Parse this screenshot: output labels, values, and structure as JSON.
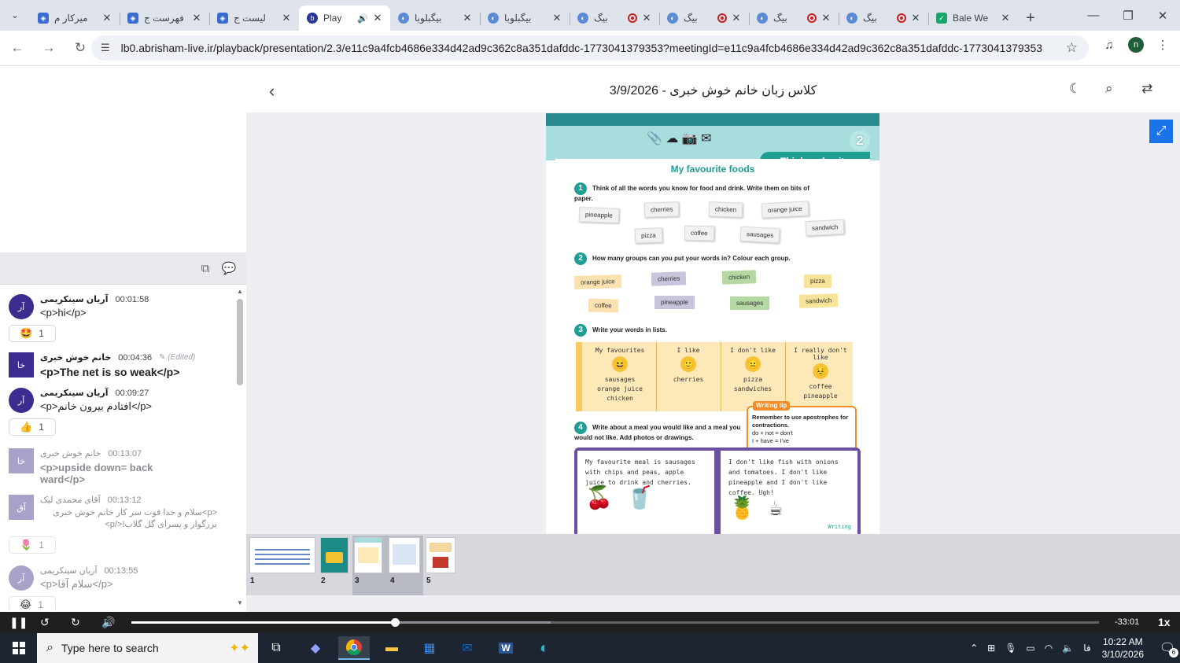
{
  "browser": {
    "tabs": [
      {
        "title": "میرکار م",
        "favicon": "app-icon",
        "active": false,
        "recording": false
      },
      {
        "title": "فهرست ج",
        "favicon": "app-icon",
        "active": false,
        "recording": false
      },
      {
        "title": "لیست ج",
        "favicon": "app-icon",
        "active": false,
        "recording": false
      },
      {
        "title": "Play",
        "favicon": "bbb-icon",
        "active": true,
        "recording": false,
        "audio": true
      },
      {
        "title": "بیگبلوبا",
        "favicon": "bbb-icon",
        "active": false,
        "recording": false
      },
      {
        "title": "بیگبلوبا",
        "favicon": "bbb-icon",
        "active": false,
        "recording": false
      },
      {
        "title": "بیگ",
        "favicon": "bbb-icon",
        "active": false,
        "recording": true
      },
      {
        "title": "بیگ",
        "favicon": "bbb-icon",
        "active": false,
        "recording": true
      },
      {
        "title": "بیگ",
        "favicon": "bbb-icon",
        "active": false,
        "recording": true
      },
      {
        "title": "بیگ",
        "favicon": "bbb-icon",
        "active": false,
        "recording": true
      },
      {
        "title": "Bale We",
        "favicon": "bale-icon",
        "active": false,
        "recording": false
      }
    ],
    "url": "lb0.abrisham-live.ir/playback/presentation/2.3/e11c9a4fcb4686e334d42ad9c362c8a351dafddc-1773041379353?meetingId=e11c9a4fcb4686e334d42ad9c362c8a351dafddc-1773041379353",
    "profile_initial": "n"
  },
  "presentation": {
    "title": "کلاس زبان خانم خوش خبری - 3/9/2026",
    "thumbnails": [
      "1",
      "2",
      "3",
      "4",
      "5"
    ],
    "current_slide": "3"
  },
  "slide": {
    "page_number": "2",
    "section": "Think and write",
    "heading": "My favourite foods",
    "q1": "Think of all the words you know for food and drink. Write them on bits of paper.",
    "q2": "How many groups can you put your words in? Colour each group.",
    "q3": "Write your words in lists.",
    "q4": "Write about a meal you would like and a meal you would not like. Add photos or drawings.",
    "words": [
      "pineapple",
      "cherries",
      "chicken",
      "orange juice",
      "pizza",
      "coffee",
      "sausages",
      "sandwich"
    ],
    "groups": [
      "orange juice",
      "cherries",
      "chicken",
      "pizza",
      "coffee",
      "pineapple",
      "sausages",
      "sandwich"
    ],
    "list_headers": [
      "My favourites",
      "I like",
      "I don't like",
      "I really don't like"
    ],
    "list_values": [
      "sausages\norange juice\nchicken",
      "cherries",
      "pizza\nsandwiches",
      "coffee\npineapple"
    ],
    "tip_title": "Writing tip",
    "tip_text": "Remember to use apostrophes for contractions.",
    "tip_ex1": "do + not = don't",
    "tip_ex2": "I + have = I've",
    "page_left": "My favourite meal is sausages with chips and peas, apple juice to drink and cherries.",
    "page_right": "I don't like fish with onions and tomatoes. I don't like pineapple and I don't like coffee. Ugh!",
    "writing_label": "Writing"
  },
  "chat": {
    "messages": [
      {
        "initials": "آر",
        "name": "آریان سینکریمی",
        "time": "00:01:58",
        "body": "<p>hi</p>",
        "reaction": {
          "emoji": "🤩",
          "count": "1"
        }
      },
      {
        "initials": "خا",
        "name": "خانم خوش خبری",
        "time": "00:04:36",
        "edited": "(Edited)",
        "body": "<p>The net is so weak</p>"
      },
      {
        "initials": "آر",
        "name": "آریان سینکریمی",
        "time": "00:09:27",
        "body": "<p>افتادم بیرون خانم</p>",
        "reaction": {
          "emoji": "👍",
          "count": "1"
        }
      },
      {
        "initials": "خا",
        "name": "خانم خوش خبری",
        "time": "00:13:07",
        "body": "<p>upside down= back ward</p>"
      },
      {
        "initials": "آق",
        "name": "آقای محمدی لیک",
        "time": "00:13:12",
        "body": "<p>سلام و خدا قوت سر کار خانم خوش خبری بزرگوار و پسرای گل گلاب!</p>",
        "reaction": {
          "emoji": "🌷",
          "count": "1"
        }
      },
      {
        "initials": "آر",
        "name": "آریان سینکریمی",
        "time": "00:13:55",
        "body": "<p>سلام آقا</p>",
        "reaction": {
          "emoji": "😂",
          "count": "1"
        }
      }
    ]
  },
  "player": {
    "progress": 0.272,
    "buffered": 0.433,
    "remaining": "-33:01",
    "speed": "1x"
  },
  "taskbar": {
    "search_placeholder": "Type here to search",
    "time": "10:22 AM",
    "date": "3/10/2026",
    "lang": "فا",
    "notifications": "6"
  },
  "colors": {
    "accent": "#1a73e8",
    "teal": "#1f9e93",
    "player": "#1f1f1f",
    "taskbar": "#1c2531"
  }
}
